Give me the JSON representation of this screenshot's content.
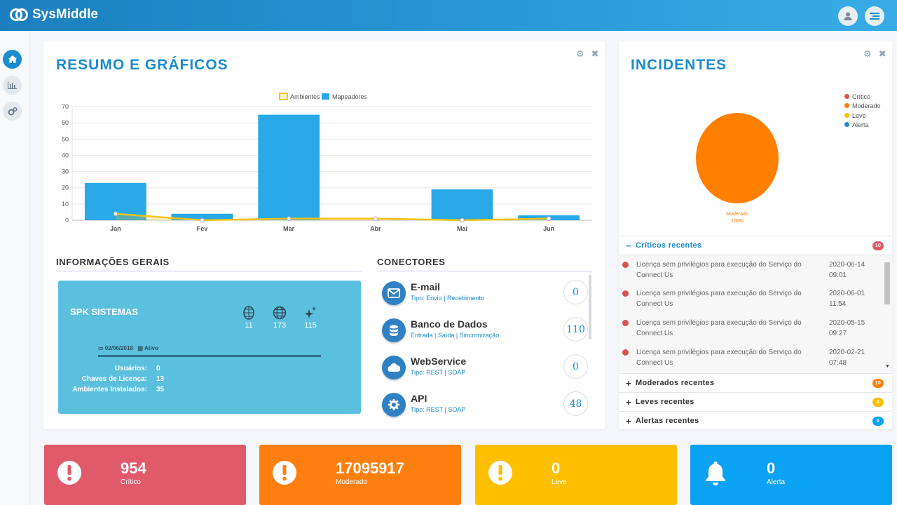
{
  "app": {
    "brand": "SysMiddle"
  },
  "sidebar": {
    "items": [
      "home",
      "reports",
      "settings"
    ]
  },
  "resumo": {
    "title": "RESUMO E GRÁFICOS",
    "legend": [
      "Ambientes",
      "Mapeadores"
    ]
  },
  "chart_data": {
    "type": "bar",
    "categories": [
      "Jan",
      "Fev",
      "Mar",
      "Abr",
      "Mai",
      "Jun"
    ],
    "series": [
      {
        "name": "Mapeadores",
        "type": "bar",
        "color": "#29a9e6",
        "values": [
          23,
          4,
          65,
          0,
          19,
          3
        ]
      },
      {
        "name": "Ambientes",
        "type": "line",
        "color": "#f5c518",
        "values": [
          4,
          0,
          1,
          1,
          0,
          1
        ]
      }
    ],
    "ylim": [
      0,
      70
    ],
    "yticks": [
      0,
      10,
      20,
      30,
      40,
      50,
      60,
      70
    ],
    "legend_position": "top-center",
    "grid": true
  },
  "info": {
    "title": "INFORMAÇÕES GERAIS",
    "company": "SPK SISTEMAS",
    "stats": [
      {
        "icon": "building-icon",
        "value": "11"
      },
      {
        "icon": "globe-icon",
        "value": "173"
      },
      {
        "icon": "sparkles-icon",
        "value": "115"
      }
    ],
    "date": "02/06/2018",
    "status": "Ativo",
    "rows": [
      {
        "label": "Usuários:",
        "value": "0"
      },
      {
        "label": "Chaves de Licença:",
        "value": "13"
      },
      {
        "label": "Ambientes Instalados:",
        "value": "35"
      }
    ]
  },
  "connectors": {
    "title": "CONECTORES",
    "items": [
      {
        "name": "E-mail",
        "sub": "Tipo: Envio | Recebimento",
        "count": "0",
        "icon": "envelope-icon"
      },
      {
        "name": "Banco de Dados",
        "sub": "Entrada | Saída | Sincronização",
        "count": "110",
        "icon": "database-icon"
      },
      {
        "name": "WebService",
        "sub": "Tipo: REST | SOAP",
        "count": "0",
        "icon": "cloud-icon"
      },
      {
        "name": "API",
        "sub": "Tipo: REST | SOAP",
        "count": "48",
        "icon": "gear-icon"
      }
    ]
  },
  "incidentes": {
    "title": "INCIDENTES",
    "legend": [
      {
        "label": "Crítico",
        "color": "#d9534f"
      },
      {
        "label": "Moderado",
        "color": "#ff8000"
      },
      {
        "label": "Leve",
        "color": "#f5c000"
      },
      {
        "label": "Alerta",
        "color": "#1b8ccc"
      }
    ],
    "pie": {
      "label": "Moderado",
      "percent": "100%",
      "color": "#ff8000"
    },
    "criticos": {
      "label": "Críticos recentes",
      "badge": "10",
      "items": [
        {
          "text": "Licença sem privilégios para execução do Serviço do Connect Us",
          "date": "2020-06-14",
          "time": "09:01"
        },
        {
          "text": "Licença sem privilégios para execução do Serviço do Connect Us",
          "date": "2020-06-01",
          "time": "11:54"
        },
        {
          "text": "Licença sem privilégios para execução do Serviço do Connect Us",
          "date": "2020-05-15",
          "time": "09:27"
        },
        {
          "text": "Licença sem privilégios para execução do Serviço do Connect Us",
          "date": "2020-02-21",
          "time": "07:48"
        }
      ]
    },
    "moderados": {
      "label": "Moderados recentes",
      "badge": "10"
    },
    "leves": {
      "label": "Leves recentes",
      "badge": "0"
    },
    "alertas": {
      "label": "Alertas recentes",
      "badge": "0"
    }
  },
  "summary": [
    {
      "value": "954",
      "label": "Crítico",
      "color": "#e15a6a",
      "icon": "exclamation-icon"
    },
    {
      "value": "17095917",
      "label": "Moderado",
      "color": "#ff7f0e",
      "icon": "exclamation-icon"
    },
    {
      "value": "0",
      "label": "Leve",
      "color": "#fdbf00",
      "icon": "exclamation-icon"
    },
    {
      "value": "0",
      "label": "Alerta",
      "color": "#0aa2f2",
      "icon": "bell-icon"
    }
  ]
}
